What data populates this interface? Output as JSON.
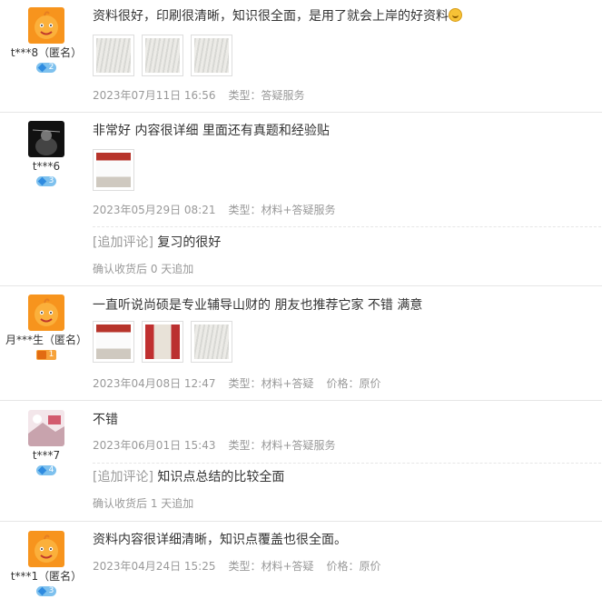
{
  "reviews": [
    {
      "username": "t***8（匿名）",
      "level": "2",
      "text": "资料很好，印刷很清晰，知识很全面，是用了就会上岸的好资料",
      "emoji": "smile-emoji",
      "date": "2023年07月11日 16:56",
      "type": "类型：答疑服务"
    },
    {
      "username": "t***6",
      "level": "3",
      "text": "非常好 内容很详细 里面还有真题和经验贴",
      "date": "2023年05月29日 08:21",
      "type": "类型：材料+答疑服务",
      "append_tag": "[追加评论]",
      "append_text": "复习的很好",
      "append_meta": "确认收货后 0 天追加"
    },
    {
      "username": "月***生（匿名）",
      "level": "1",
      "text": "一直听说尚硕是专业辅导山财的 朋友也推荐它家 不错 满意",
      "date": "2023年04月08日 12:47",
      "type": "类型：材料+答疑",
      "price": "价格：原价"
    },
    {
      "username": "t***7",
      "level": "4",
      "text": "不错",
      "date": "2023年06月01日 15:43",
      "type": "类型：材料+答疑服务",
      "append_tag": "[追加评论]",
      "append_text": "知识点总结的比较全面",
      "append_meta": "确认收货后 1 天追加"
    },
    {
      "username": "t***1（匿名）",
      "level": "3",
      "text": "资料内容很详细清晰，知识点覆盖也很全面。",
      "date": "2023年04月24日 15:25",
      "type": "类型：材料+答疑",
      "price": "价格：原价"
    }
  ]
}
